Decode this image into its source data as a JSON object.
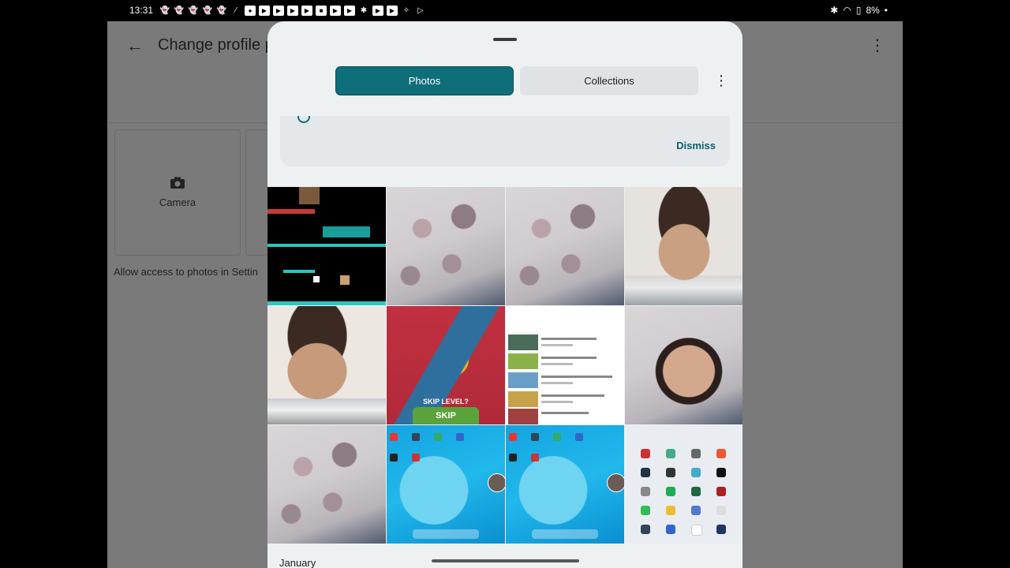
{
  "status_bar": {
    "time": "13:31",
    "battery": "8%",
    "notification_icons": [
      "snapchat-icon",
      "snapchat-icon",
      "snapchat-icon",
      "snapchat-icon",
      "snapchat-icon",
      "magic-wand-icon",
      "app-icon",
      "youtube-icon",
      "youtube-icon",
      "youtube-icon",
      "youtube-icon",
      "red-app-icon",
      "youtube-icon",
      "youtube-icon",
      "puzzle-icon",
      "youtube-icon",
      "youtube-icon",
      "assistant-icon",
      "play-store-icon"
    ]
  },
  "background_app": {
    "title": "Change profile p",
    "camera_label": "Camera",
    "hint": "Allow access to photos in Settin"
  },
  "sheet": {
    "tabs": [
      {
        "label": "Photos",
        "selected": true
      },
      {
        "label": "Collections",
        "selected": false
      }
    ],
    "more_label": "⋮",
    "card": {
      "dismiss_label": "Dismiss"
    },
    "section_label": "January"
  },
  "photos": [
    "game-screenshot",
    "pillow-photo",
    "pillow-photo",
    "boy-smiling-photo",
    "boy-funny-face-photo",
    "skip-level-game-screenshot",
    "youtube-list-screenshot",
    "boy-selfie-over-pillow-photo",
    "pillow-photo",
    "tablet-home-screen-screenshot",
    "tablet-home-screen-screenshot",
    "app-drawer-screenshot"
  ],
  "skip_screen": {
    "prompt": "SKIP LEVEL?",
    "button": "SKIP"
  },
  "colors": {
    "accent": "#0e6e7a",
    "sheet_bg": "#eef1f2",
    "scrim": "#7a7a7a"
  }
}
